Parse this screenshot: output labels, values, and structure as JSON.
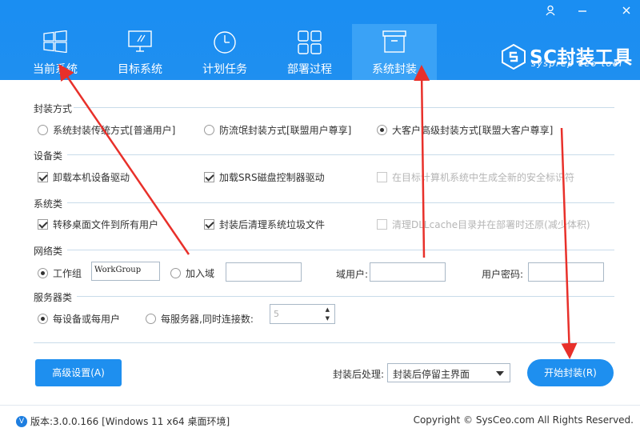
{
  "window": {
    "controls": {
      "user": "ℛ",
      "minimize": "—",
      "close": "✕"
    }
  },
  "tabs": [
    {
      "label": "当前系统",
      "icon": "windows-icon"
    },
    {
      "label": "目标系统",
      "icon": "monitor-icon"
    },
    {
      "label": "计划任务",
      "icon": "clock-icon"
    },
    {
      "label": "部署过程",
      "icon": "grid-icon"
    },
    {
      "label": "系统封装",
      "icon": "package-box-icon",
      "active": true
    }
  ],
  "logo": {
    "brand": "SC封装工具",
    "tagline": "sysprep ceo tool"
  },
  "sections": {
    "pack_mode": {
      "title": "封装方式",
      "options": [
        "系统封装传统方式[普通用户]",
        "防流氓封装方式[联盟用户尊享]",
        "大客户高级封装方式[联盟大客户尊享]"
      ],
      "selected": 2
    },
    "devices": {
      "title": "设备类",
      "options": [
        "卸载本机设备驱动",
        "加载SRS磁盘控制器驱动",
        "在目标计算机系统中生成全新的安全标识符"
      ]
    },
    "system": {
      "title": "系统类",
      "options": [
        "转移桌面文件到所有用户",
        "封装后清理系统垃圾文件",
        "清理DLLcache目录并在部署时还原(减少体积)"
      ]
    },
    "network": {
      "title": "网络类",
      "workgroup_label": "工作组",
      "workgroup_value": "WorkGroup",
      "domain_label": "加入域",
      "domain_user_label": "域用户:",
      "user_password_label": "用户密码:"
    },
    "server": {
      "title": "服务器类",
      "per_device_label": "每设备或每用户",
      "per_server_label": "每服务器,同时连接数:",
      "connections": "5"
    }
  },
  "bottom": {
    "advanced_button": "高级设置(A)",
    "post_action_label": "封装后处理:",
    "post_action_value": "封装后停留主界面",
    "start_button": "开始封装(R)"
  },
  "footer": {
    "version_icon": "V",
    "version": "版本:3.0.0.166 [Windows 11 x64 桌面环境]",
    "copyright": "Copyright © SysCeo.com All Rights Reserved."
  },
  "colors": {
    "header": "#1f8ff0",
    "active_tab": "#3aa2f6",
    "button": "#1e8fef",
    "annotation": "#e8302a"
  }
}
